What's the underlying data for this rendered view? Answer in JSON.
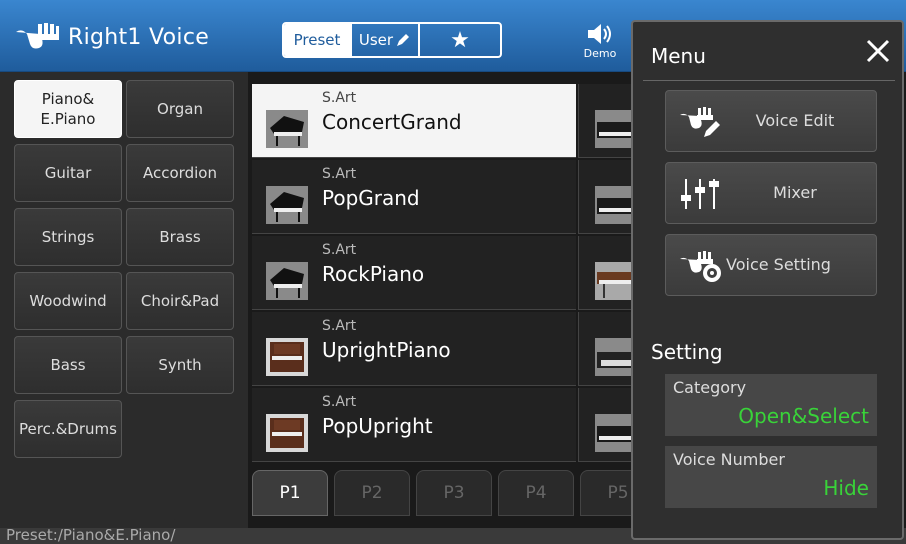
{
  "header": {
    "title": "Right1 Voice",
    "tabs": {
      "preset": "Preset",
      "user": "User",
      "favorite": "★"
    },
    "demo_label": "Demo"
  },
  "categories": [
    {
      "label": "Piano&\nE.Piano",
      "selected": true
    },
    {
      "label": "Organ"
    },
    {
      "label": "Guitar"
    },
    {
      "label": "Accordion"
    },
    {
      "label": "Strings"
    },
    {
      "label": "Brass"
    },
    {
      "label": "Woodwind"
    },
    {
      "label": "Choir&Pad"
    },
    {
      "label": "Bass"
    },
    {
      "label": "Synth"
    },
    {
      "label": "Perc.&Drums"
    }
  ],
  "voices": [
    {
      "sub": "S.Art",
      "name": "ConcertGrand",
      "selected": true
    },
    {
      "sub": "S.Art",
      "name": "PopGrand"
    },
    {
      "sub": "S.Art",
      "name": "RockPiano"
    },
    {
      "sub": "S.Art",
      "name": "UprightPiano"
    },
    {
      "sub": "S.Art",
      "name": "PopUpright"
    }
  ],
  "pages": [
    "P1",
    "P2",
    "P3",
    "P4",
    "P5"
  ],
  "status": {
    "path": "Preset:/Piano&E.Piano/"
  },
  "menu": {
    "title": "Menu",
    "buttons": {
      "voice_edit": "Voice Edit",
      "mixer": "Mixer",
      "voice_setting": "Voice Setting"
    },
    "setting_title": "Setting",
    "category": {
      "label": "Category",
      "value": "Open&Select"
    },
    "voice_number": {
      "label": "Voice Number",
      "value": "Hide"
    }
  },
  "colors": {
    "header": "#2a72b8",
    "value_green": "#39d339"
  }
}
